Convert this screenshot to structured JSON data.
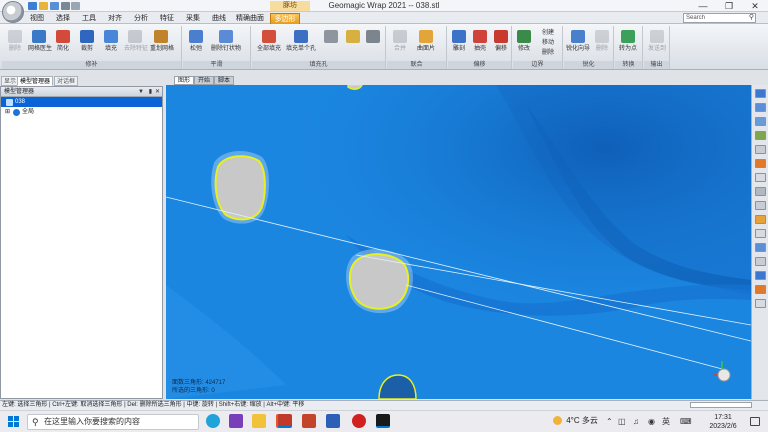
{
  "window": {
    "title": "Geomagic Wrap 2021 -- 038.stl",
    "context_tab_label": "豚坊",
    "minimize": "—",
    "maximize": "❐",
    "close": "✕"
  },
  "menu": {
    "tabs": [
      "视图",
      "选择",
      "工具",
      "对齐",
      "分析",
      "特征",
      "采集",
      "曲线",
      "精确曲面",
      "多边形"
    ],
    "active_tab": "多边形",
    "search_placeholder": "Search"
  },
  "ribbon": {
    "groups": [
      {
        "label": "修补",
        "buttons": [
          "删除",
          "网格医生",
          "简化",
          "裁剪",
          "填充",
          "去除特征",
          "重划网格"
        ]
      },
      {
        "label": "平滑",
        "buttons": [
          "松弛",
          "删除钉状物"
        ]
      },
      {
        "label": "填充孔",
        "buttons": [
          "全部填充",
          "填充单个孔"
        ]
      },
      {
        "label": "联合",
        "buttons": [
          "合并",
          "曲面片"
        ]
      },
      {
        "label": "偏移",
        "buttons": [
          "雕刻",
          "抽壳",
          "偏移"
        ]
      },
      {
        "label": "边界",
        "buttons": [
          "修改",
          "创建",
          "移动",
          "删除"
        ]
      },
      {
        "label": "锐化",
        "buttons": [
          "锐化向导",
          "删除"
        ]
      },
      {
        "label": "转换",
        "buttons": [
          "转为点"
        ]
      },
      {
        "label": "输出",
        "buttons": [
          "发送到"
        ]
      }
    ]
  },
  "left_panel": {
    "tabs": [
      "显示",
      "模型管理器",
      "对话框"
    ],
    "active_tab": "模型管理器",
    "header": "模型管理器",
    "tree": [
      {
        "label": "038",
        "selected": true
      },
      {
        "label": "全局",
        "selected": false
      }
    ]
  },
  "viewport": {
    "tabs": [
      "图形",
      "开始",
      "脚本"
    ],
    "active_tab": "图形",
    "stats_line1": "面数三角形: 424717",
    "stats_line2": "所选的三角形: 0"
  },
  "statusbar": {
    "text": "左键: 选择三角形 | Ctrl+左键: 取消选择三角形 | Del: 删除所选三角形 | 中键: 旋转 | Shift+右键: 缩放 | Alt+中键: 平移"
  },
  "taskbar": {
    "search_placeholder": "在这里输入你要搜索的内容",
    "weather": "4°C 多云",
    "ime": "英",
    "time": "17:31",
    "date": "2023/2/6"
  },
  "colors": {
    "viewport_blue": "#1b86e0",
    "hole_fill": "#c8c8c8",
    "boundary_yellow": "#e8f020",
    "active_tab": "#f0a51c",
    "selection": "#0a64d8"
  }
}
